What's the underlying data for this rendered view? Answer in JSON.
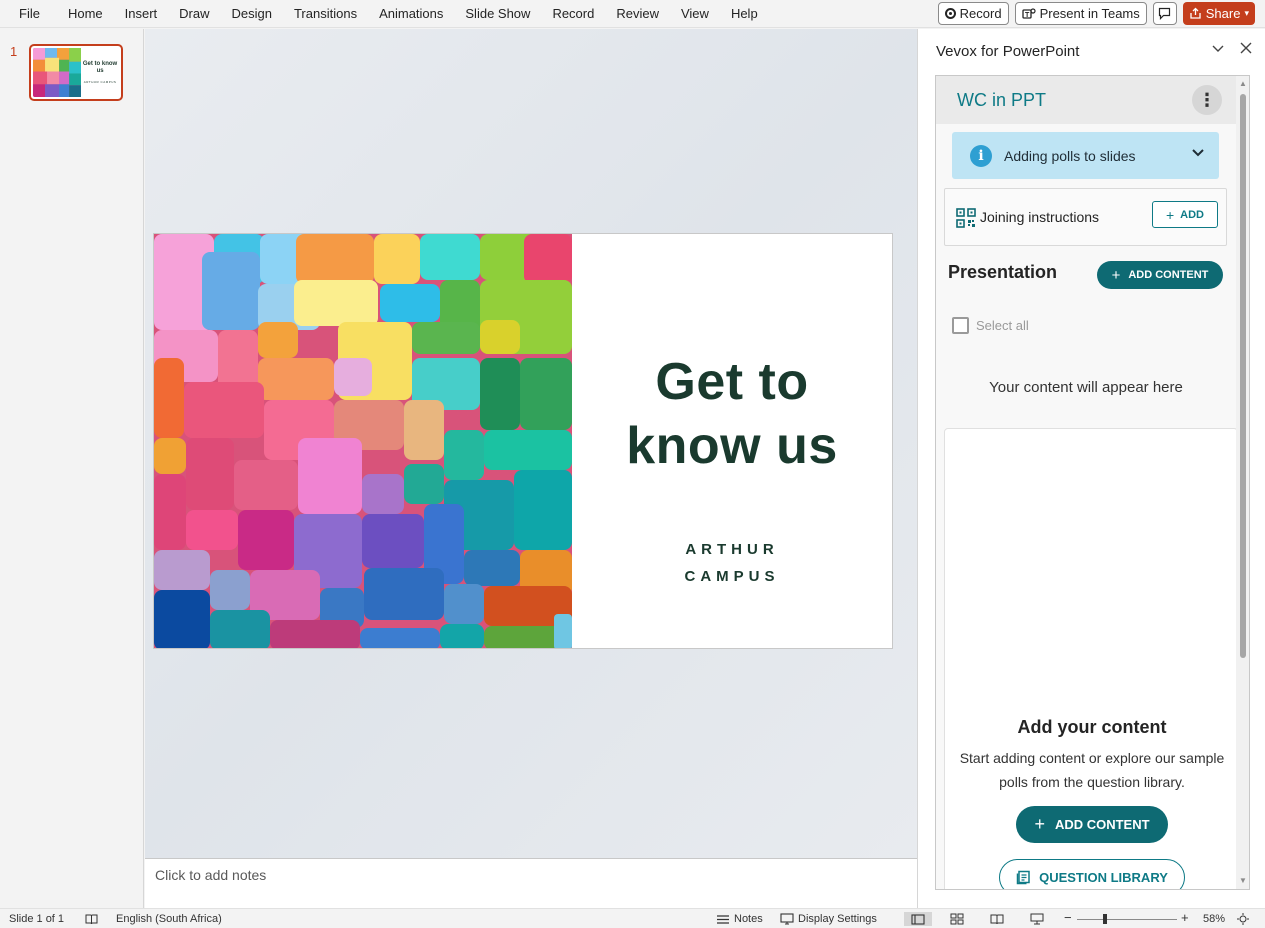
{
  "menubar": {
    "tabs": [
      "File",
      "Home",
      "Insert",
      "Draw",
      "Design",
      "Transitions",
      "Animations",
      "Slide Show",
      "Record",
      "Review",
      "View",
      "Help"
    ],
    "record_label": "Record",
    "teams_label": "Present in Teams",
    "share_label": "Share"
  },
  "thumbnails": {
    "slide_number": "1",
    "thumb_title": "Get to know us",
    "thumb_sub": "ARTHUR CAMPUS"
  },
  "slide": {
    "title_line1": "Get to",
    "title_line2": "know us",
    "subtitle_line1": "ARTHUR",
    "subtitle_line2": "CAMPUS"
  },
  "notes": {
    "placeholder": "Click to add notes"
  },
  "taskpane": {
    "header": "Vevox for PowerPoint",
    "frame_title": "WC in PPT",
    "info_banner": "Adding polls to slides",
    "joining": "Joining instructions",
    "add_label": "ADD",
    "presentation_heading": "Presentation",
    "add_content_label": "ADD CONTENT",
    "select_all": "Select all",
    "placeholder": "Your content will appear here",
    "card": {
      "title": "Add your content",
      "desc": "Start adding content or explore our sample polls from the question library.",
      "add_content": "ADD CONTENT",
      "question_library": "QUESTION LIBRARY"
    }
  },
  "status": {
    "slide_count": "Slide 1 of 1",
    "language": "English (South Africa)",
    "notes": "Notes",
    "display_settings": "Display Settings",
    "zoom": "58%"
  },
  "colors": {
    "accent": "#c43e1c",
    "vevox_teal": "#0e6a73",
    "slide_text": "#1a3a2e"
  }
}
